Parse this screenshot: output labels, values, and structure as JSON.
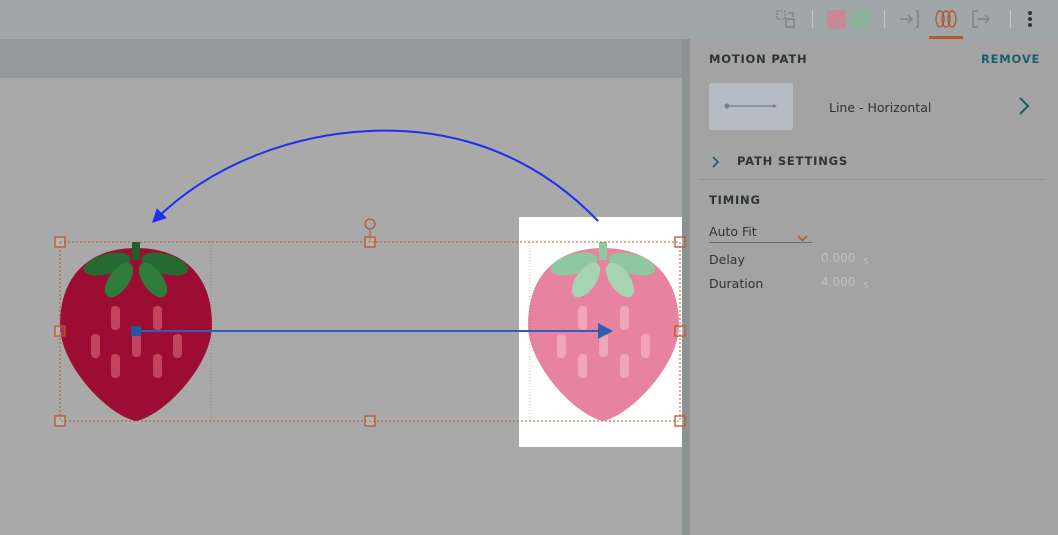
{
  "panel": {
    "motion_path_title": "MOTION PATH",
    "remove_label": "REMOVE",
    "path_name": "Line - Horizontal",
    "path_settings_label": "PATH SETTINGS",
    "timing_title": "TIMING",
    "fit_select_value": "Auto Fit",
    "delay_label": "Delay",
    "delay_value": "0.000",
    "delay_unit": "s",
    "duration_label": "Duration",
    "duration_value": "4.000",
    "duration_unit": "s"
  },
  "toolbar": {
    "icons": [
      "arrange-icon",
      "fill-color-swatch",
      "stroke-color-swatch",
      "entrance-animation-icon",
      "motion-path-icon",
      "exit-animation-icon",
      "more-options-icon"
    ]
  },
  "colors": {
    "accent": "#17606a",
    "selection": "#b5582f",
    "path_arrow": "#2f5fb0",
    "curve_arrow": "#1f2ef0",
    "strawberry": "#9d0c33",
    "strawberry_ghost": "#e7839e",
    "leaf": "#246a32",
    "leaf_ghost": "#8fc79e"
  }
}
